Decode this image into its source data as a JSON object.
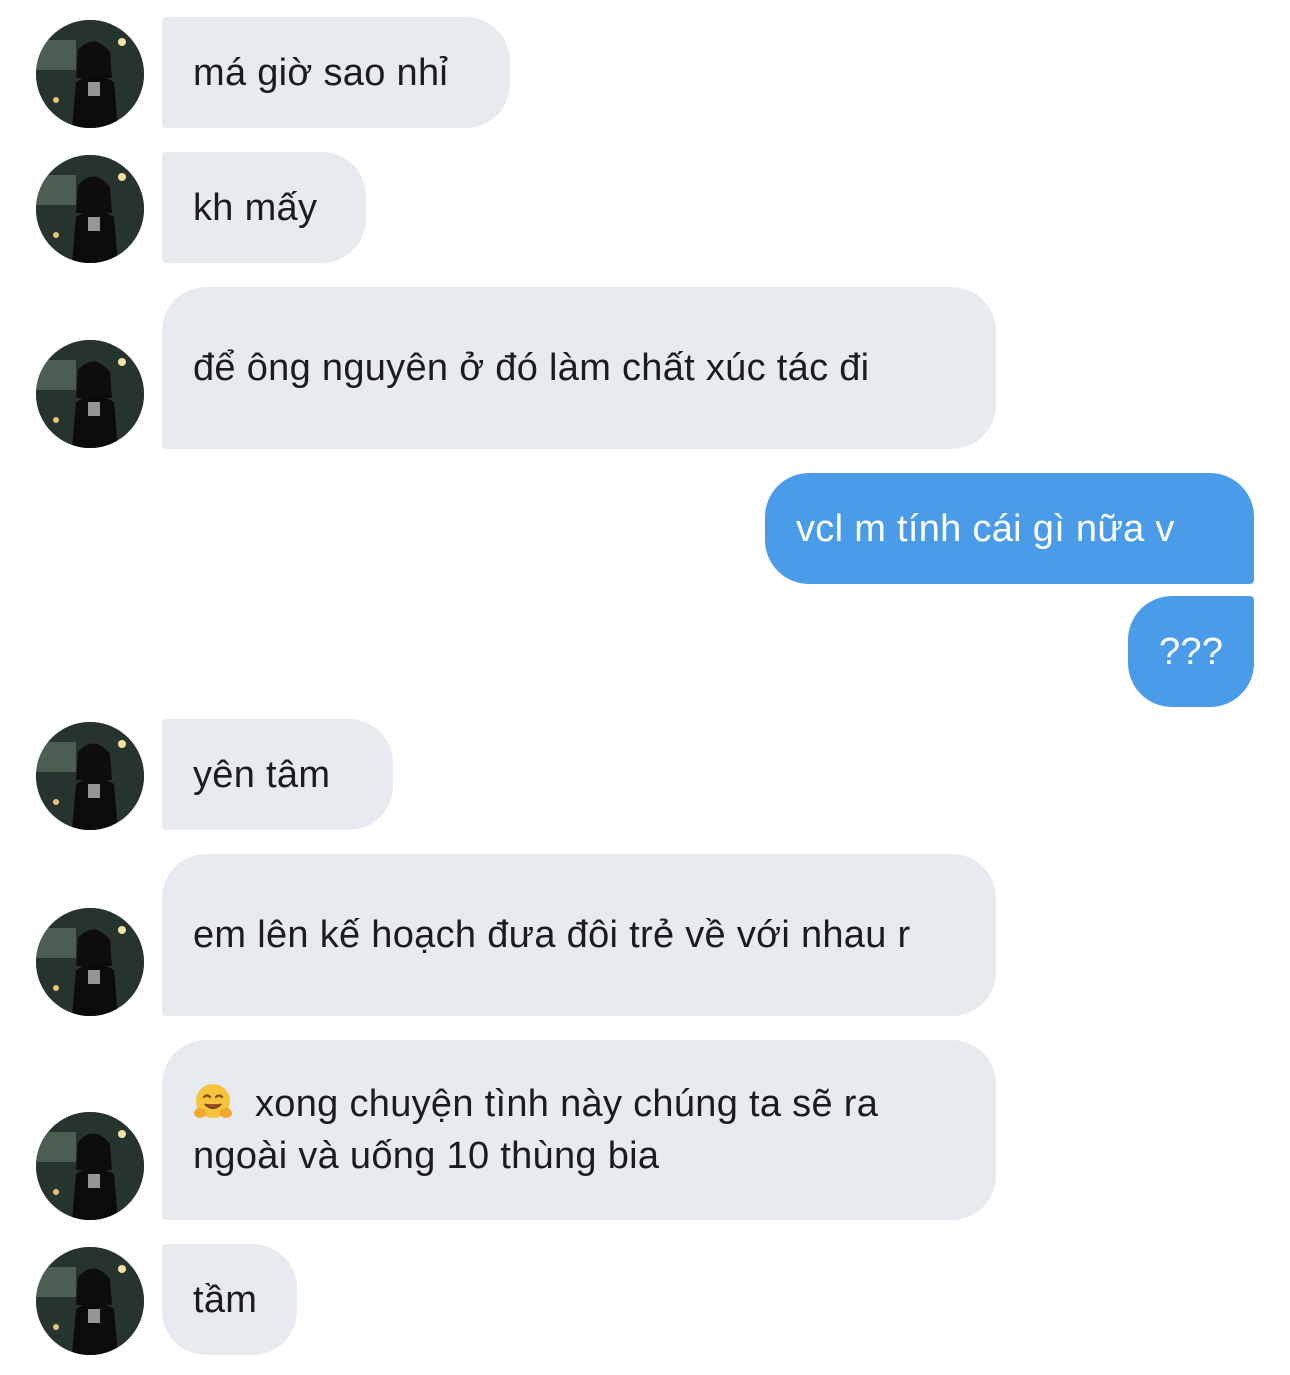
{
  "messages": [
    {
      "side": "incoming",
      "text": "má giờ sao nhỉ"
    },
    {
      "side": "incoming",
      "text": "kh mấy"
    },
    {
      "side": "incoming",
      "text": "để ông nguyên ở đó làm chất xúc tác đi"
    },
    {
      "side": "outgoing",
      "text": "vcl m tính cái gì nữa v"
    },
    {
      "side": "outgoing",
      "text": "???"
    },
    {
      "side": "incoming",
      "text": "yên tâm"
    },
    {
      "side": "incoming",
      "text": "em lên kế hoạch đưa đôi trẻ về với nhau r"
    },
    {
      "side": "incoming",
      "emoji": "hugging-face-emoji",
      "text": "xong chuyện tình này chúng ta sẽ ra ngoài và uống 10 thùng bia"
    },
    {
      "side": "incoming",
      "text": "tầm"
    }
  ],
  "colors": {
    "incoming_bubble": "#e7eaee",
    "incoming_text": "#1c1c1e",
    "outgoing_bubble": "#4a9be8",
    "outgoing_text": "#ffffff",
    "background": "#ffffff"
  }
}
